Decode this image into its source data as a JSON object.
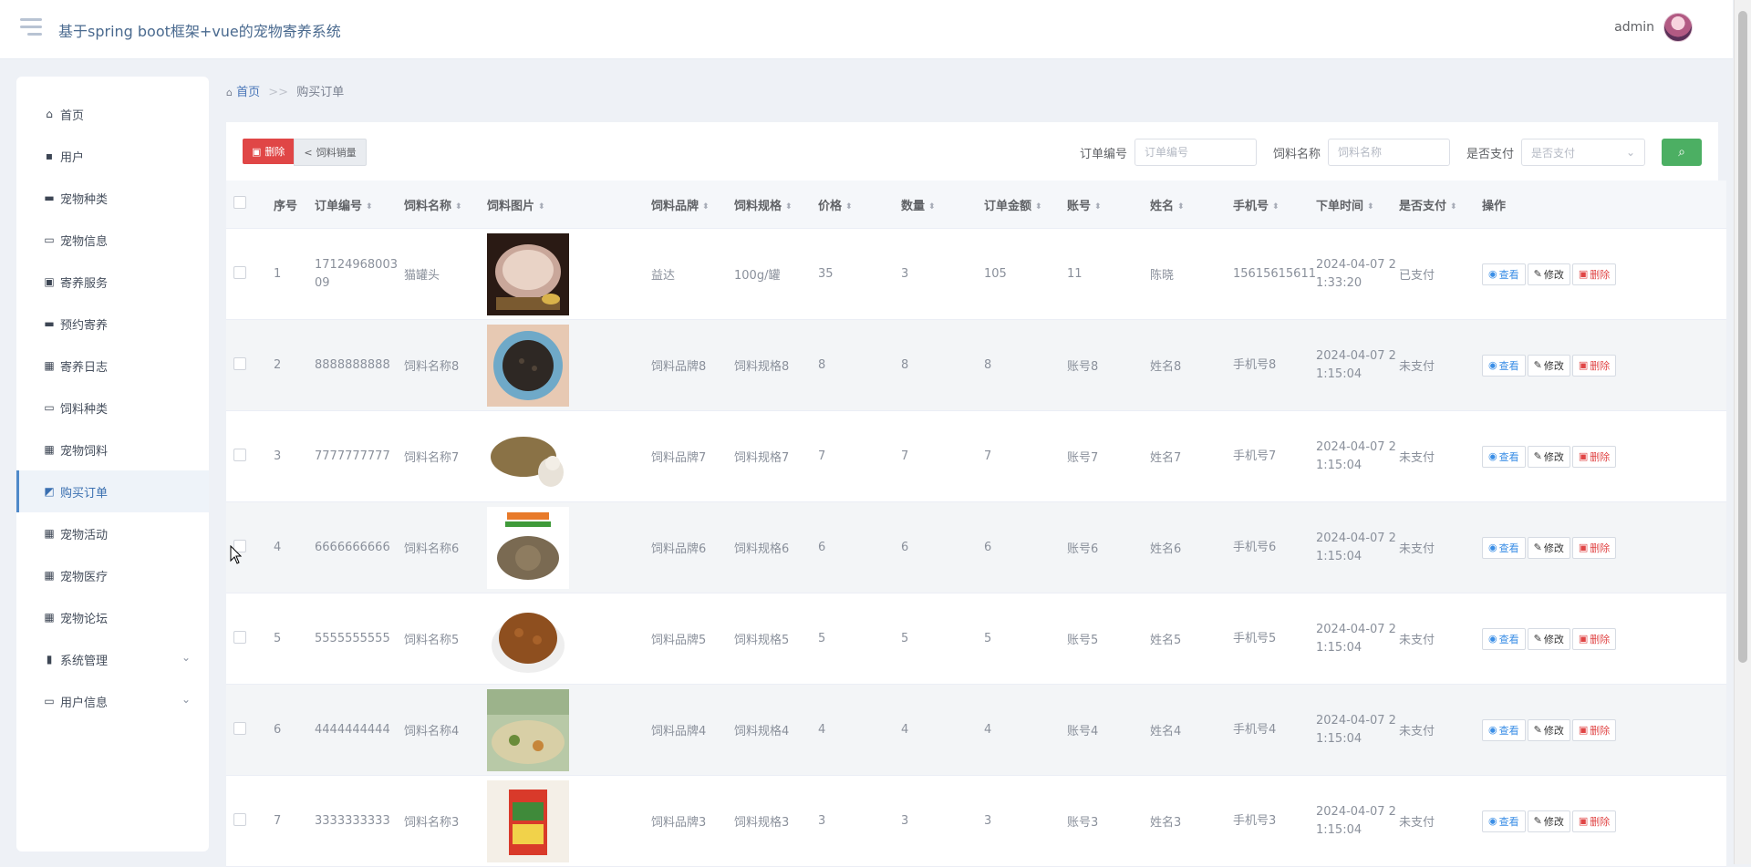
{
  "header": {
    "title": "基于spring boot框架+vue的宠物寄养系统",
    "user": "admin"
  },
  "sidebar": {
    "items": [
      {
        "label": "首页",
        "icon": "home-icon",
        "glyph": "⌂"
      },
      {
        "label": "用户",
        "icon": "briefcase-icon",
        "glyph": "▪"
      },
      {
        "label": "宠物种类",
        "icon": "message-icon",
        "glyph": "▬"
      },
      {
        "label": "宠物信息",
        "icon": "monitor-icon",
        "glyph": "▭"
      },
      {
        "label": "寄养服务",
        "icon": "clipboard-icon",
        "glyph": "▣"
      },
      {
        "label": "预约寄养",
        "icon": "chat-icon",
        "glyph": "▬"
      },
      {
        "label": "寄养日志",
        "icon": "grid-icon",
        "glyph": "▦"
      },
      {
        "label": "饲料种类",
        "icon": "screen-icon",
        "glyph": "▭"
      },
      {
        "label": "宠物饲料",
        "icon": "grid-icon",
        "glyph": "▦"
      },
      {
        "label": "购买订单",
        "icon": "chart-icon",
        "glyph": "◩"
      },
      {
        "label": "宠物活动",
        "icon": "grid-icon",
        "glyph": "▦"
      },
      {
        "label": "宠物医疗",
        "icon": "grid-icon",
        "glyph": "▦"
      },
      {
        "label": "宠物论坛",
        "icon": "grid-icon",
        "glyph": "▦"
      },
      {
        "label": "系统管理",
        "icon": "bar-chart-icon",
        "glyph": "▮"
      },
      {
        "label": "用户信息",
        "icon": "card-icon",
        "glyph": "▭"
      }
    ]
  },
  "breadcrumb": {
    "home": "首页",
    "sep": ">>",
    "current": "购买订单"
  },
  "toolbar": {
    "delete": "删除",
    "sales": "饲料销量"
  },
  "search": {
    "order_no_label": "订单编号",
    "order_no_placeholder": "订单编号",
    "feed_name_label": "饲料名称",
    "feed_name_placeholder": "饲料名称",
    "paid_label": "是否支付",
    "paid_placeholder": "是否支付"
  },
  "table": {
    "headers": [
      "序号",
      "订单编号",
      "饲料名称",
      "饲料图片",
      "饲料品牌",
      "饲料规格",
      "价格",
      "数量",
      "订单金额",
      "账号",
      "姓名",
      "手机号",
      "下单时间",
      "是否支付",
      "操作"
    ],
    "rows": [
      {
        "idx": "1",
        "order": "1712496800309",
        "name": "猫罐头",
        "img": "canned-food",
        "brand": "益达",
        "spec": "100g/罐",
        "price": "35",
        "qty": "3",
        "amount": "105",
        "account": "11",
        "uname": "陈晓",
        "phone": "15615615611",
        "time": "2024-04-07 21:33:20",
        "paid": "已支付"
      },
      {
        "idx": "2",
        "order": "8888888888",
        "name": "饲料名称8",
        "img": "kibble-plate",
        "brand": "饲料品牌8",
        "spec": "饲料规格8",
        "price": "8",
        "qty": "8",
        "amount": "8",
        "account": "账号8",
        "uname": "姓名8",
        "phone": "手机号8",
        "time": "2024-04-07 21:15:04",
        "paid": "未支付"
      },
      {
        "idx": "3",
        "order": "7777777777",
        "name": "饲料名称7",
        "img": "kibble-pile",
        "brand": "饲料品牌7",
        "spec": "饲料规格7",
        "price": "7",
        "qty": "7",
        "amount": "7",
        "account": "账号7",
        "uname": "姓名7",
        "phone": "手机号7",
        "time": "2024-04-07 21:15:04",
        "paid": "未支付"
      },
      {
        "idx": "4",
        "order": "6666666666",
        "name": "饲料名称6",
        "img": "rabbit-food",
        "brand": "饲料品牌6",
        "spec": "饲料规格6",
        "price": "6",
        "qty": "6",
        "amount": "6",
        "account": "账号6",
        "uname": "姓名6",
        "phone": "手机号6",
        "time": "2024-04-07 21:15:04",
        "paid": "未支付"
      },
      {
        "idx": "5",
        "order": "5555555555",
        "name": "饲料名称5",
        "img": "kibble-brown",
        "brand": "饲料品牌5",
        "spec": "饲料规格5",
        "price": "5",
        "qty": "5",
        "amount": "5",
        "account": "账号5",
        "uname": "姓名5",
        "phone": "手机号5",
        "time": "2024-04-07 21:15:04",
        "paid": "未支付"
      },
      {
        "idx": "6",
        "order": "4444444444",
        "name": "饲料名称4",
        "img": "mixed-food",
        "brand": "饲料品牌4",
        "spec": "饲料规格4",
        "price": "4",
        "qty": "4",
        "amount": "4",
        "account": "账号4",
        "uname": "姓名4",
        "phone": "手机号4",
        "time": "2024-04-07 21:15:04",
        "paid": "未支付"
      },
      {
        "idx": "7",
        "order": "3333333333",
        "name": "饲料名称3",
        "img": "food-bag",
        "brand": "饲料品牌3",
        "spec": "饲料规格3",
        "price": "3",
        "qty": "3",
        "amount": "3",
        "account": "账号3",
        "uname": "姓名3",
        "phone": "手机号3",
        "time": "2024-04-07 21:15:04",
        "paid": "未支付"
      }
    ],
    "actions": {
      "view": "查看",
      "edit": "修改",
      "delete": "删除"
    }
  }
}
